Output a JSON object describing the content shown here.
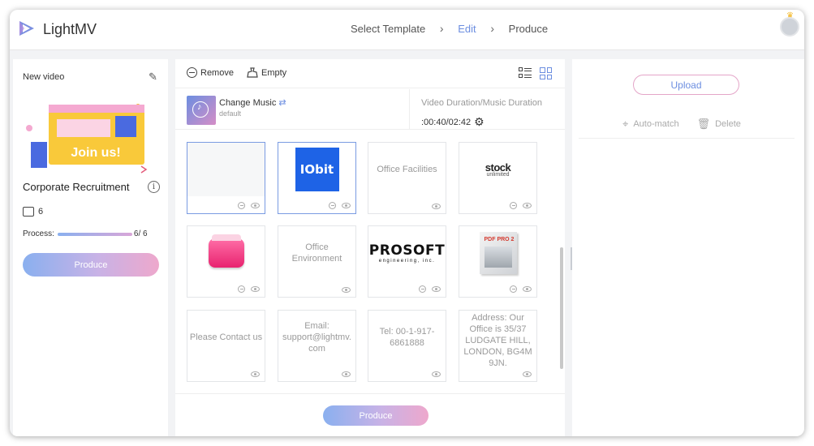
{
  "app": {
    "name": "LightMV"
  },
  "steps": [
    {
      "label": "Select Template",
      "active": false
    },
    {
      "label": "Edit",
      "active": true
    },
    {
      "label": "Produce",
      "active": false
    }
  ],
  "project": {
    "name": "New video",
    "template_title": "Corporate Recruitment",
    "thumbnail_text": "Join us!",
    "image_count": "6",
    "process_label": "Process:",
    "process_text": "6/ 6",
    "process_fraction": 1.0,
    "produce_label": "Produce"
  },
  "toolbar": {
    "remove_label": "Remove",
    "empty_label": "Empty"
  },
  "music": {
    "title": "Change Music",
    "subtitle": "default",
    "duration_label": "Video Duration/Music Duration",
    "duration_value": ":00:40/02:42"
  },
  "tiles": [
    {
      "type": "image",
      "content": "",
      "selected": true,
      "has_minus": true
    },
    {
      "type": "image",
      "content": "IObit",
      "selected": true,
      "has_minus": true
    },
    {
      "type": "text",
      "content": "Office Facilities",
      "selected": false,
      "has_minus": false
    },
    {
      "type": "image",
      "content": "stock unlimited",
      "selected": false,
      "has_minus": true
    },
    {
      "type": "image",
      "content": "",
      "selected": false,
      "has_minus": true
    },
    {
      "type": "text",
      "content": "Office Environment",
      "selected": false,
      "has_minus": false
    },
    {
      "type": "image",
      "content": "PROSOFT engineering, inc.",
      "selected": false,
      "has_minus": true
    },
    {
      "type": "image",
      "content": "PDF PRO 2",
      "selected": false,
      "has_minus": true
    },
    {
      "type": "text",
      "content": "Please Contact us",
      "selected": false,
      "has_minus": false
    },
    {
      "type": "text",
      "content": "Email: support@lightmv.com",
      "selected": false,
      "has_minus": false
    },
    {
      "type": "text",
      "content": "Tel: 00-1-917-6861888",
      "selected": false,
      "has_minus": false
    },
    {
      "type": "text",
      "content": "Address: Our Office is 35/37 LUDGATE HILL, LONDON, BG4M 9JN.",
      "selected": false,
      "has_minus": false
    }
  ],
  "tile_text": {
    "t3": "Office Facilities",
    "t6_l1": "Office",
    "t6_l2": "Environment",
    "t9": "Please Contact us",
    "t10_l1": "Email:",
    "t10_l2": "support@lightmv.",
    "t10_l3": "com",
    "t11_l1": "Tel: 00-1-917-",
    "t11_l2": "6861888",
    "t12_l1": "Address: Our",
    "t12_l2": "Office is 35/37",
    "t12_l3": "LUDGATE HILL,",
    "t12_l4": "LONDON, BG4M",
    "t12_l5": "9JN.",
    "iobit": "IObit",
    "stock_1": "stock",
    "stock_2": "unlimited",
    "prosoft_1": "PROSOFT",
    "prosoft_2": "engineering, inc.",
    "pdf": "PDF PRO 2"
  },
  "center_produce_label": "Produce",
  "right": {
    "upload_label": "Upload",
    "automatch_label": "Auto-match",
    "delete_label": "Delete"
  },
  "colors": {
    "accent": "#6c8ee0",
    "gradient_start": "#8ab0ef",
    "gradient_end": "#eea8cc",
    "iobit_blue": "#1e63e6"
  }
}
